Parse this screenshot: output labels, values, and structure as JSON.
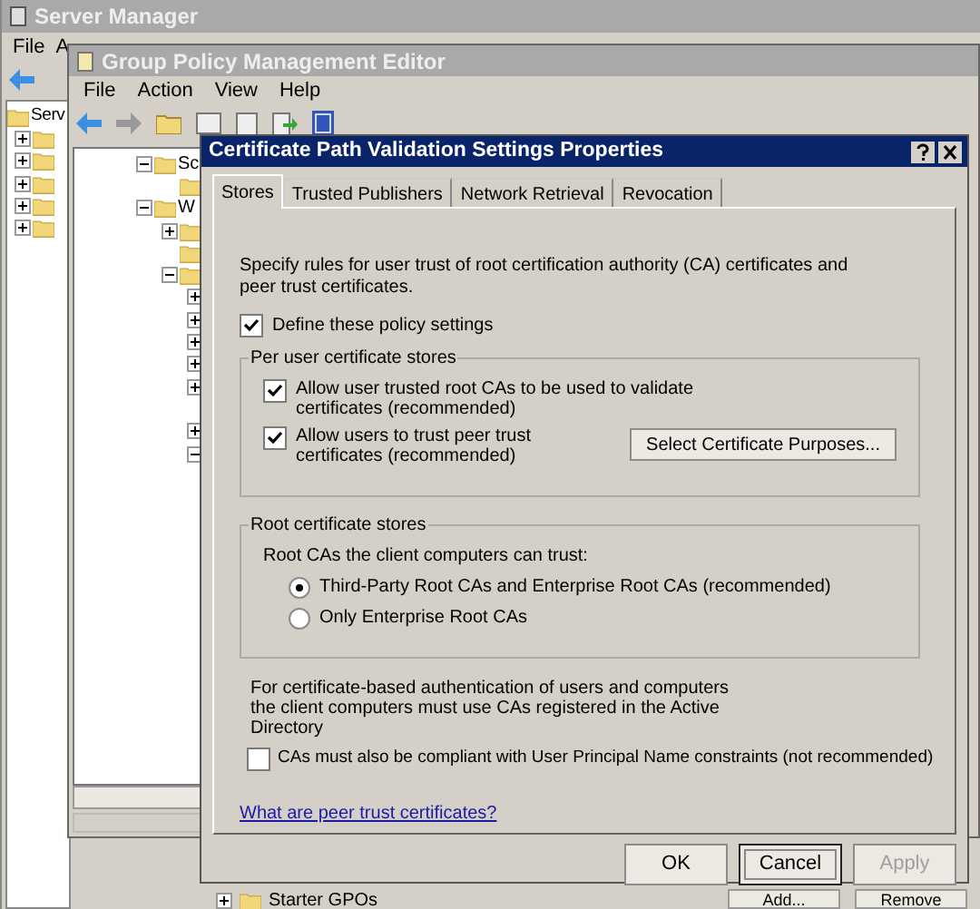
{
  "server_manager": {
    "title": "Server Manager",
    "menu": [
      "File",
      "A"
    ],
    "tree": [
      {
        "label": "Serv",
        "kind": "root",
        "children": [
          {
            "kind": "node",
            "expanded": false
          },
          {
            "kind": "node",
            "expanded": false
          },
          {
            "kind": "node",
            "expanded": false
          },
          {
            "kind": "node",
            "expanded": false
          },
          {
            "kind": "node",
            "expanded": false
          }
        ]
      }
    ],
    "bottom_items": [
      {
        "label": "Starter GPOs",
        "expanded": false
      }
    ],
    "bottom_buttons": [
      "Add...",
      "Remove"
    ]
  },
  "gpme": {
    "title": "Group Policy Management Editor",
    "menu": [
      "File",
      "Action",
      "View",
      "Help"
    ],
    "tree": [
      {
        "label": "Sc",
        "kind": "node",
        "expanded": true,
        "children": [
          {
            "kind": "leaf"
          }
        ]
      },
      {
        "label": "W",
        "kind": "node",
        "expanded": true,
        "children": [
          {
            "kind": "node",
            "expanded": false
          },
          {
            "kind": "leaf"
          },
          {
            "kind": "node",
            "expanded": true,
            "children": [
              {
                "kind": "node",
                "expanded": false
              },
              {
                "kind": "node",
                "expanded": false
              },
              {
                "kind": "node",
                "expanded": false
              },
              {
                "kind": "node",
                "expanded": false
              },
              {
                "kind": "node",
                "expanded": false
              },
              {
                "kind": "leaf"
              },
              {
                "kind": "node",
                "expanded": false
              },
              {
                "kind": "node",
                "expanded": true
              }
            ]
          }
        ]
      }
    ]
  },
  "dialog": {
    "title": "Certificate Path Validation Settings Properties",
    "tabs": [
      {
        "label": "Stores",
        "selected": true
      },
      {
        "label": "Trusted Publishers",
        "selected": false
      },
      {
        "label": "Network Retrieval",
        "selected": false
      },
      {
        "label": "Revocation",
        "selected": false
      }
    ],
    "intro": "Specify rules for user trust of root certification authority (CA) certificates and peer trust certificates.",
    "define": {
      "label": "Define these policy settings",
      "checked": true
    },
    "per_user": {
      "title": "Per user certificate stores",
      "options": [
        {
          "label": "Allow user trusted root CAs to be used to validate certificates (recommended)",
          "checked": true
        },
        {
          "label": "Allow users to trust peer trust certificates (recommended)",
          "checked": true
        }
      ],
      "button": "Select Certificate Purposes..."
    },
    "root_stores": {
      "title": "Root certificate stores",
      "prompt": "Root CAs the client computers can trust:",
      "options": [
        {
          "label": "Third-Party Root CAs and Enterprise Root CAs (recommended)",
          "selected": true
        },
        {
          "label": "Only Enterprise Root CAs",
          "selected": false
        }
      ]
    },
    "auth_note": "For certificate-based authentication of users and computers the client computers must use CAs registered in the Active Directory",
    "upn": {
      "label": "CAs must also be compliant with User Principal Name constraints (not recommended)",
      "checked": false
    },
    "link": "What are peer trust certificates?",
    "buttons": [
      {
        "label": "OK",
        "disabled": false,
        "selected": false
      },
      {
        "label": "Cancel",
        "disabled": false,
        "selected": true
      },
      {
        "label": "Apply",
        "disabled": true,
        "selected": false
      }
    ]
  }
}
